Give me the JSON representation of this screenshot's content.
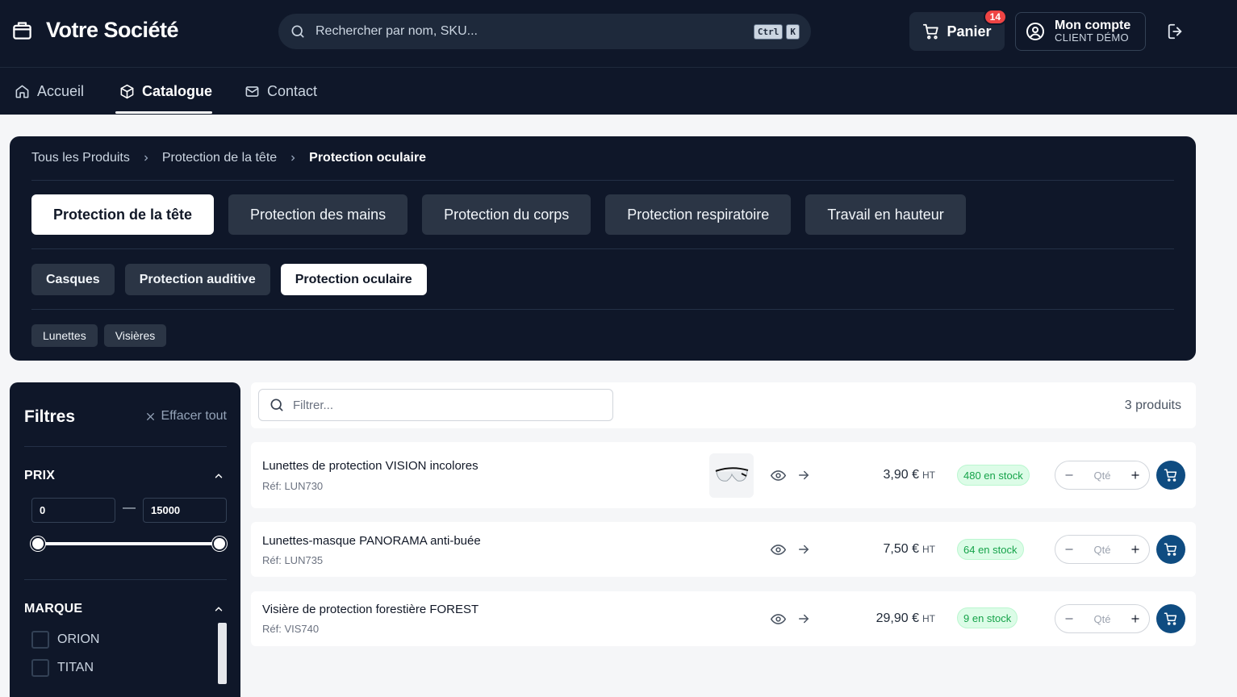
{
  "header": {
    "brand_name": "Votre Société",
    "search_placeholder": "Rechercher par nom, SKU...",
    "shortcut_keys": [
      "Ctrl",
      "K"
    ],
    "cart_label": "Panier",
    "cart_count": "14",
    "account_title": "Mon compte",
    "account_subtitle": "CLIENT DÉMO"
  },
  "nav": {
    "items": [
      {
        "label": "Accueil",
        "icon": "home-icon"
      },
      {
        "label": "Catalogue",
        "icon": "box-icon",
        "active": true
      },
      {
        "label": "Contact",
        "icon": "mail-icon"
      }
    ]
  },
  "breadcrumb": [
    "Tous les Produits",
    "Protection de la tête",
    "Protection oculaire"
  ],
  "categories": {
    "level1": [
      "Protection de la tête",
      "Protection des mains",
      "Protection du corps",
      "Protection respiratoire",
      "Travail en hauteur"
    ],
    "level1_active": "Protection de la tête",
    "level2": [
      "Casques",
      "Protection auditive",
      "Protection oculaire"
    ],
    "level2_active": "Protection oculaire",
    "level3": [
      "Lunettes",
      "Visières"
    ]
  },
  "filters": {
    "title": "Filtres",
    "clear_label": "Effacer tout",
    "price_title": "PRIX",
    "price_min": "0",
    "price_max": "15000",
    "brand_title": "MARQUE",
    "brands": [
      "ORION",
      "TITAN"
    ]
  },
  "toolbar": {
    "filter_placeholder": "Filtrer...",
    "count_label": "3 produits"
  },
  "products": [
    {
      "name": "Lunettes de protection VISION incolores",
      "ref": "Réf: LUN730",
      "price": "3,90 €",
      "price_suffix": "HT",
      "stock": "480 en stock",
      "has_image": true
    },
    {
      "name": "Lunettes-masque PANORAMA anti-buée",
      "ref": "Réf: LUN735",
      "price": "7,50 €",
      "price_suffix": "HT",
      "stock": "64 en stock",
      "has_image": false
    },
    {
      "name": "Visière de protection forestière FOREST",
      "ref": "Réf: VIS740",
      "price": "29,90 €",
      "price_suffix": "HT",
      "stock": "9 en stock",
      "has_image": false
    }
  ],
  "qty_placeholder": "Qté",
  "colors": {
    "dark": "#0f1729",
    "accent": "#0f4c81",
    "badge": "#ef4444",
    "stock_green": "#16a34a"
  }
}
